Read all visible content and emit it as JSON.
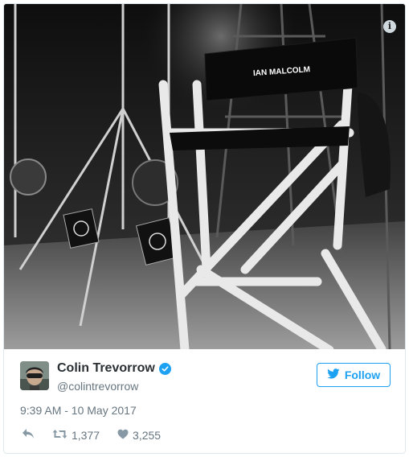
{
  "photo": {
    "chair_back_text": "IAN MALCOLM",
    "info_icon": "info-icon",
    "info_label": "i"
  },
  "author": {
    "name": "Colin Trevorrow",
    "handle": "@colintrevorrow",
    "verified_icon": "verified-badge-icon"
  },
  "follow_button": {
    "label": "Follow",
    "icon": "twitter-bird-icon"
  },
  "tweet": {
    "timestamp": "9:39 AM - 10 May 2017"
  },
  "actions": {
    "reply_icon": "reply-icon",
    "retweet_icon": "retweet-icon",
    "retweet_count": "1,377",
    "like_icon": "heart-icon",
    "like_count": "3,255"
  },
  "colors": {
    "accent": "#1da1f2",
    "text_primary": "#292f33",
    "text_secondary": "#66757f",
    "border": "#e1e8ed"
  }
}
